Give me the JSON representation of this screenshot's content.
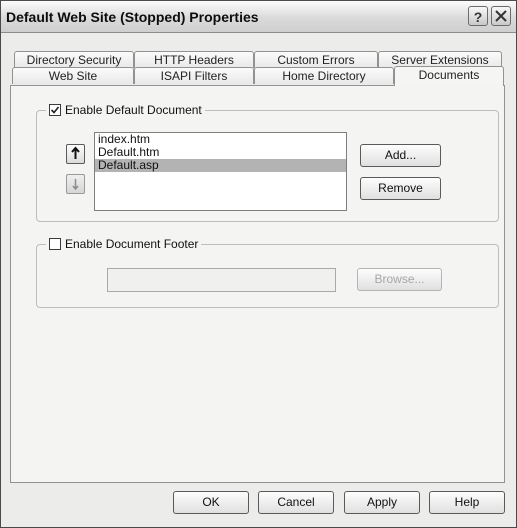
{
  "window": {
    "title": "Default Web Site (Stopped) Properties"
  },
  "title_buttons": {
    "help": "?",
    "close": "✕"
  },
  "tabs_top": [
    "Directory Security",
    "HTTP Headers",
    "Custom Errors",
    "Server Extensions"
  ],
  "tabs_bottom": [
    "Web Site",
    "ISAPI Filters",
    "Home Directory",
    "Documents"
  ],
  "active_tab": "Documents",
  "default_document": {
    "label": "Enable Default Document",
    "checked": true,
    "items": [
      "index.htm",
      "Default.htm",
      "Default.asp"
    ],
    "selected_item": "Default.asp",
    "add_label": "Add...",
    "remove_label": "Remove"
  },
  "document_footer": {
    "label": "Enable Document Footer",
    "checked": false,
    "path_value": "",
    "browse_label": "Browse..."
  },
  "footer_buttons": {
    "ok": "OK",
    "cancel": "Cancel",
    "apply": "Apply",
    "help": "Help"
  }
}
